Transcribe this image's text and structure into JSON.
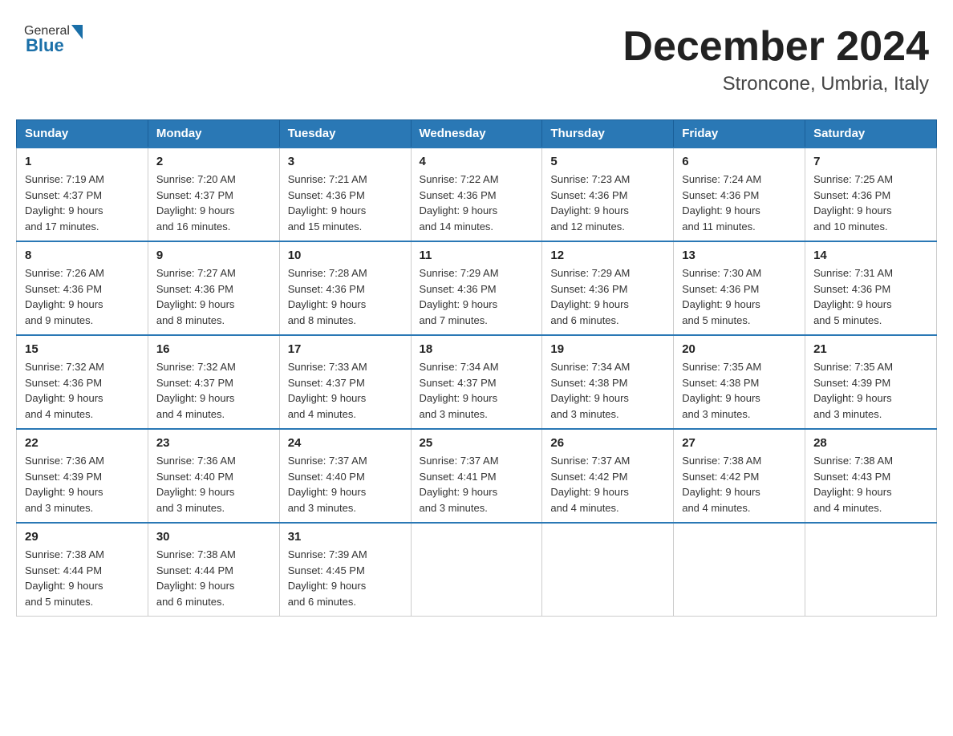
{
  "header": {
    "logo_general": "General",
    "logo_blue": "Blue",
    "month_title": "December 2024",
    "location": "Stroncone, Umbria, Italy"
  },
  "weekdays": [
    "Sunday",
    "Monday",
    "Tuesday",
    "Wednesday",
    "Thursday",
    "Friday",
    "Saturday"
  ],
  "weeks": [
    [
      {
        "day": "1",
        "sunrise": "7:19 AM",
        "sunset": "4:37 PM",
        "daylight": "9 hours and 17 minutes."
      },
      {
        "day": "2",
        "sunrise": "7:20 AM",
        "sunset": "4:37 PM",
        "daylight": "9 hours and 16 minutes."
      },
      {
        "day": "3",
        "sunrise": "7:21 AM",
        "sunset": "4:36 PM",
        "daylight": "9 hours and 15 minutes."
      },
      {
        "day": "4",
        "sunrise": "7:22 AM",
        "sunset": "4:36 PM",
        "daylight": "9 hours and 14 minutes."
      },
      {
        "day": "5",
        "sunrise": "7:23 AM",
        "sunset": "4:36 PM",
        "daylight": "9 hours and 12 minutes."
      },
      {
        "day": "6",
        "sunrise": "7:24 AM",
        "sunset": "4:36 PM",
        "daylight": "9 hours and 11 minutes."
      },
      {
        "day": "7",
        "sunrise": "7:25 AM",
        "sunset": "4:36 PM",
        "daylight": "9 hours and 10 minutes."
      }
    ],
    [
      {
        "day": "8",
        "sunrise": "7:26 AM",
        "sunset": "4:36 PM",
        "daylight": "9 hours and 9 minutes."
      },
      {
        "day": "9",
        "sunrise": "7:27 AM",
        "sunset": "4:36 PM",
        "daylight": "9 hours and 8 minutes."
      },
      {
        "day": "10",
        "sunrise": "7:28 AM",
        "sunset": "4:36 PM",
        "daylight": "9 hours and 8 minutes."
      },
      {
        "day": "11",
        "sunrise": "7:29 AM",
        "sunset": "4:36 PM",
        "daylight": "9 hours and 7 minutes."
      },
      {
        "day": "12",
        "sunrise": "7:29 AM",
        "sunset": "4:36 PM",
        "daylight": "9 hours and 6 minutes."
      },
      {
        "day": "13",
        "sunrise": "7:30 AM",
        "sunset": "4:36 PM",
        "daylight": "9 hours and 5 minutes."
      },
      {
        "day": "14",
        "sunrise": "7:31 AM",
        "sunset": "4:36 PM",
        "daylight": "9 hours and 5 minutes."
      }
    ],
    [
      {
        "day": "15",
        "sunrise": "7:32 AM",
        "sunset": "4:36 PM",
        "daylight": "9 hours and 4 minutes."
      },
      {
        "day": "16",
        "sunrise": "7:32 AM",
        "sunset": "4:37 PM",
        "daylight": "9 hours and 4 minutes."
      },
      {
        "day": "17",
        "sunrise": "7:33 AM",
        "sunset": "4:37 PM",
        "daylight": "9 hours and 4 minutes."
      },
      {
        "day": "18",
        "sunrise": "7:34 AM",
        "sunset": "4:37 PM",
        "daylight": "9 hours and 3 minutes."
      },
      {
        "day": "19",
        "sunrise": "7:34 AM",
        "sunset": "4:38 PM",
        "daylight": "9 hours and 3 minutes."
      },
      {
        "day": "20",
        "sunrise": "7:35 AM",
        "sunset": "4:38 PM",
        "daylight": "9 hours and 3 minutes."
      },
      {
        "day": "21",
        "sunrise": "7:35 AM",
        "sunset": "4:39 PM",
        "daylight": "9 hours and 3 minutes."
      }
    ],
    [
      {
        "day": "22",
        "sunrise": "7:36 AM",
        "sunset": "4:39 PM",
        "daylight": "9 hours and 3 minutes."
      },
      {
        "day": "23",
        "sunrise": "7:36 AM",
        "sunset": "4:40 PM",
        "daylight": "9 hours and 3 minutes."
      },
      {
        "day": "24",
        "sunrise": "7:37 AM",
        "sunset": "4:40 PM",
        "daylight": "9 hours and 3 minutes."
      },
      {
        "day": "25",
        "sunrise": "7:37 AM",
        "sunset": "4:41 PM",
        "daylight": "9 hours and 3 minutes."
      },
      {
        "day": "26",
        "sunrise": "7:37 AM",
        "sunset": "4:42 PM",
        "daylight": "9 hours and 4 minutes."
      },
      {
        "day": "27",
        "sunrise": "7:38 AM",
        "sunset": "4:42 PM",
        "daylight": "9 hours and 4 minutes."
      },
      {
        "day": "28",
        "sunrise": "7:38 AM",
        "sunset": "4:43 PM",
        "daylight": "9 hours and 4 minutes."
      }
    ],
    [
      {
        "day": "29",
        "sunrise": "7:38 AM",
        "sunset": "4:44 PM",
        "daylight": "9 hours and 5 minutes."
      },
      {
        "day": "30",
        "sunrise": "7:38 AM",
        "sunset": "4:44 PM",
        "daylight": "9 hours and 6 minutes."
      },
      {
        "day": "31",
        "sunrise": "7:39 AM",
        "sunset": "4:45 PM",
        "daylight": "9 hours and 6 minutes."
      },
      null,
      null,
      null,
      null
    ]
  ],
  "labels": {
    "sunrise": "Sunrise:",
    "sunset": "Sunset:",
    "daylight": "Daylight:"
  }
}
